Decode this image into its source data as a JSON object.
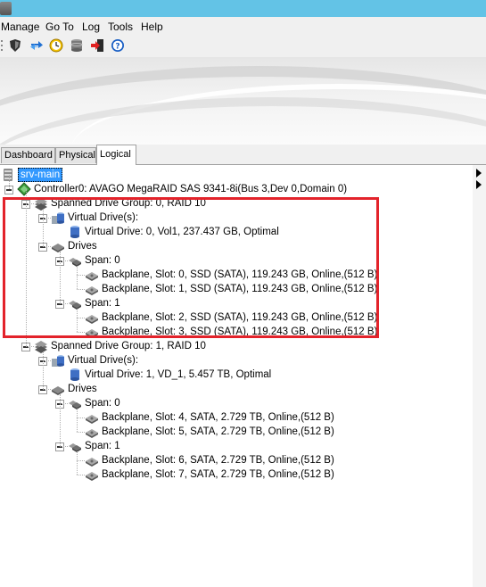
{
  "menu": {
    "items": [
      "Manage",
      "Go To",
      "Log",
      "Tools",
      "Help"
    ]
  },
  "toolbar": {
    "icons": [
      "shield-icon",
      "refresh-icon",
      "clock-icon",
      "database-icon",
      "exit-icon",
      "help-icon"
    ]
  },
  "tabs": {
    "dashboard": "Dashboard",
    "physical": "Physical",
    "logical": "Logical",
    "active": "Logical"
  },
  "tree": {
    "server": "srv-main",
    "controller": "Controller0: AVAGO MegaRAID SAS 9341-8i(Bus 3,Dev 0,Domain 0)",
    "groups": [
      {
        "label": "Spanned Drive Group: 0, RAID  10",
        "vd_header": "Virtual Drive(s):",
        "vd": "Virtual Drive: 0, Vol1, 237.437 GB, Optimal",
        "drives_header": "Drives",
        "spans": [
          {
            "label": "Span: 0",
            "drives": [
              "Backplane, Slot: 0, SSD  (SATA), 119.243 GB, Online,(512 B)",
              "Backplane, Slot: 1, SSD  (SATA), 119.243 GB, Online,(512 B)"
            ]
          },
          {
            "label": "Span: 1",
            "drives": [
              "Backplane, Slot: 2, SSD  (SATA), 119.243 GB, Online,(512 B)",
              "Backplane, Slot: 3, SSD  (SATA), 119.243 GB, Online,(512 B)"
            ]
          }
        ]
      },
      {
        "label": "Spanned Drive Group: 1, RAID  10",
        "vd_header": "Virtual Drive(s):",
        "vd": "Virtual Drive: 1, VD_1, 5.457 TB, Optimal",
        "drives_header": "Drives",
        "spans": [
          {
            "label": "Span: 0",
            "drives": [
              "Backplane, Slot: 4, SATA, 2.729 TB, Online,(512 B)",
              "Backplane, Slot: 5, SATA, 2.729 TB, Online,(512 B)"
            ]
          },
          {
            "label": "Span: 1",
            "drives": [
              "Backplane, Slot: 6, SATA, 2.729 TB, Online,(512 B)",
              "Backplane, Slot: 7, SATA, 2.729 TB, Online,(512 B)"
            ]
          }
        ]
      }
    ]
  },
  "colors": {
    "titlebar": "#63c3e6",
    "selection": "#3399ff",
    "highlight_box": "#e3232b"
  }
}
